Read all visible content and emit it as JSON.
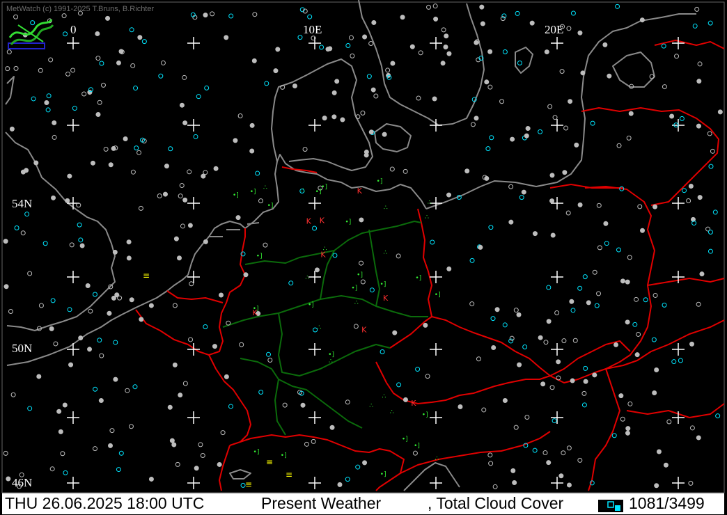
{
  "credit": "MetWatch  (c) 1991-2025 T.Bruns, B.Richter",
  "longitude_labels": [
    "0",
    "10E",
    "20E"
  ],
  "latitude_labels": [
    "54N",
    "50N",
    "46N"
  ],
  "status": {
    "datetime": "THU 26.06.2025 18:00 UTC",
    "product": "Present Weather",
    "overlay": ", Total Cloud Cover",
    "counter": "1081/3499"
  },
  "colors": {
    "background": "#000000",
    "coastline": "#8a8a8a",
    "border": "#e00000",
    "inner_border": "#0b6b0b",
    "precip_symbol": "#33ee33",
    "thunder_symbol": "#ff3030",
    "cloud_symbol": "#00e5ff",
    "station_gray": "#bdbdbd",
    "fog_symbol": "#ffff00",
    "status_bg": "#ffffff"
  },
  "icons": {
    "logo": "metwatch-logo-icon",
    "legend": "cloud-cover-legend-icon"
  }
}
